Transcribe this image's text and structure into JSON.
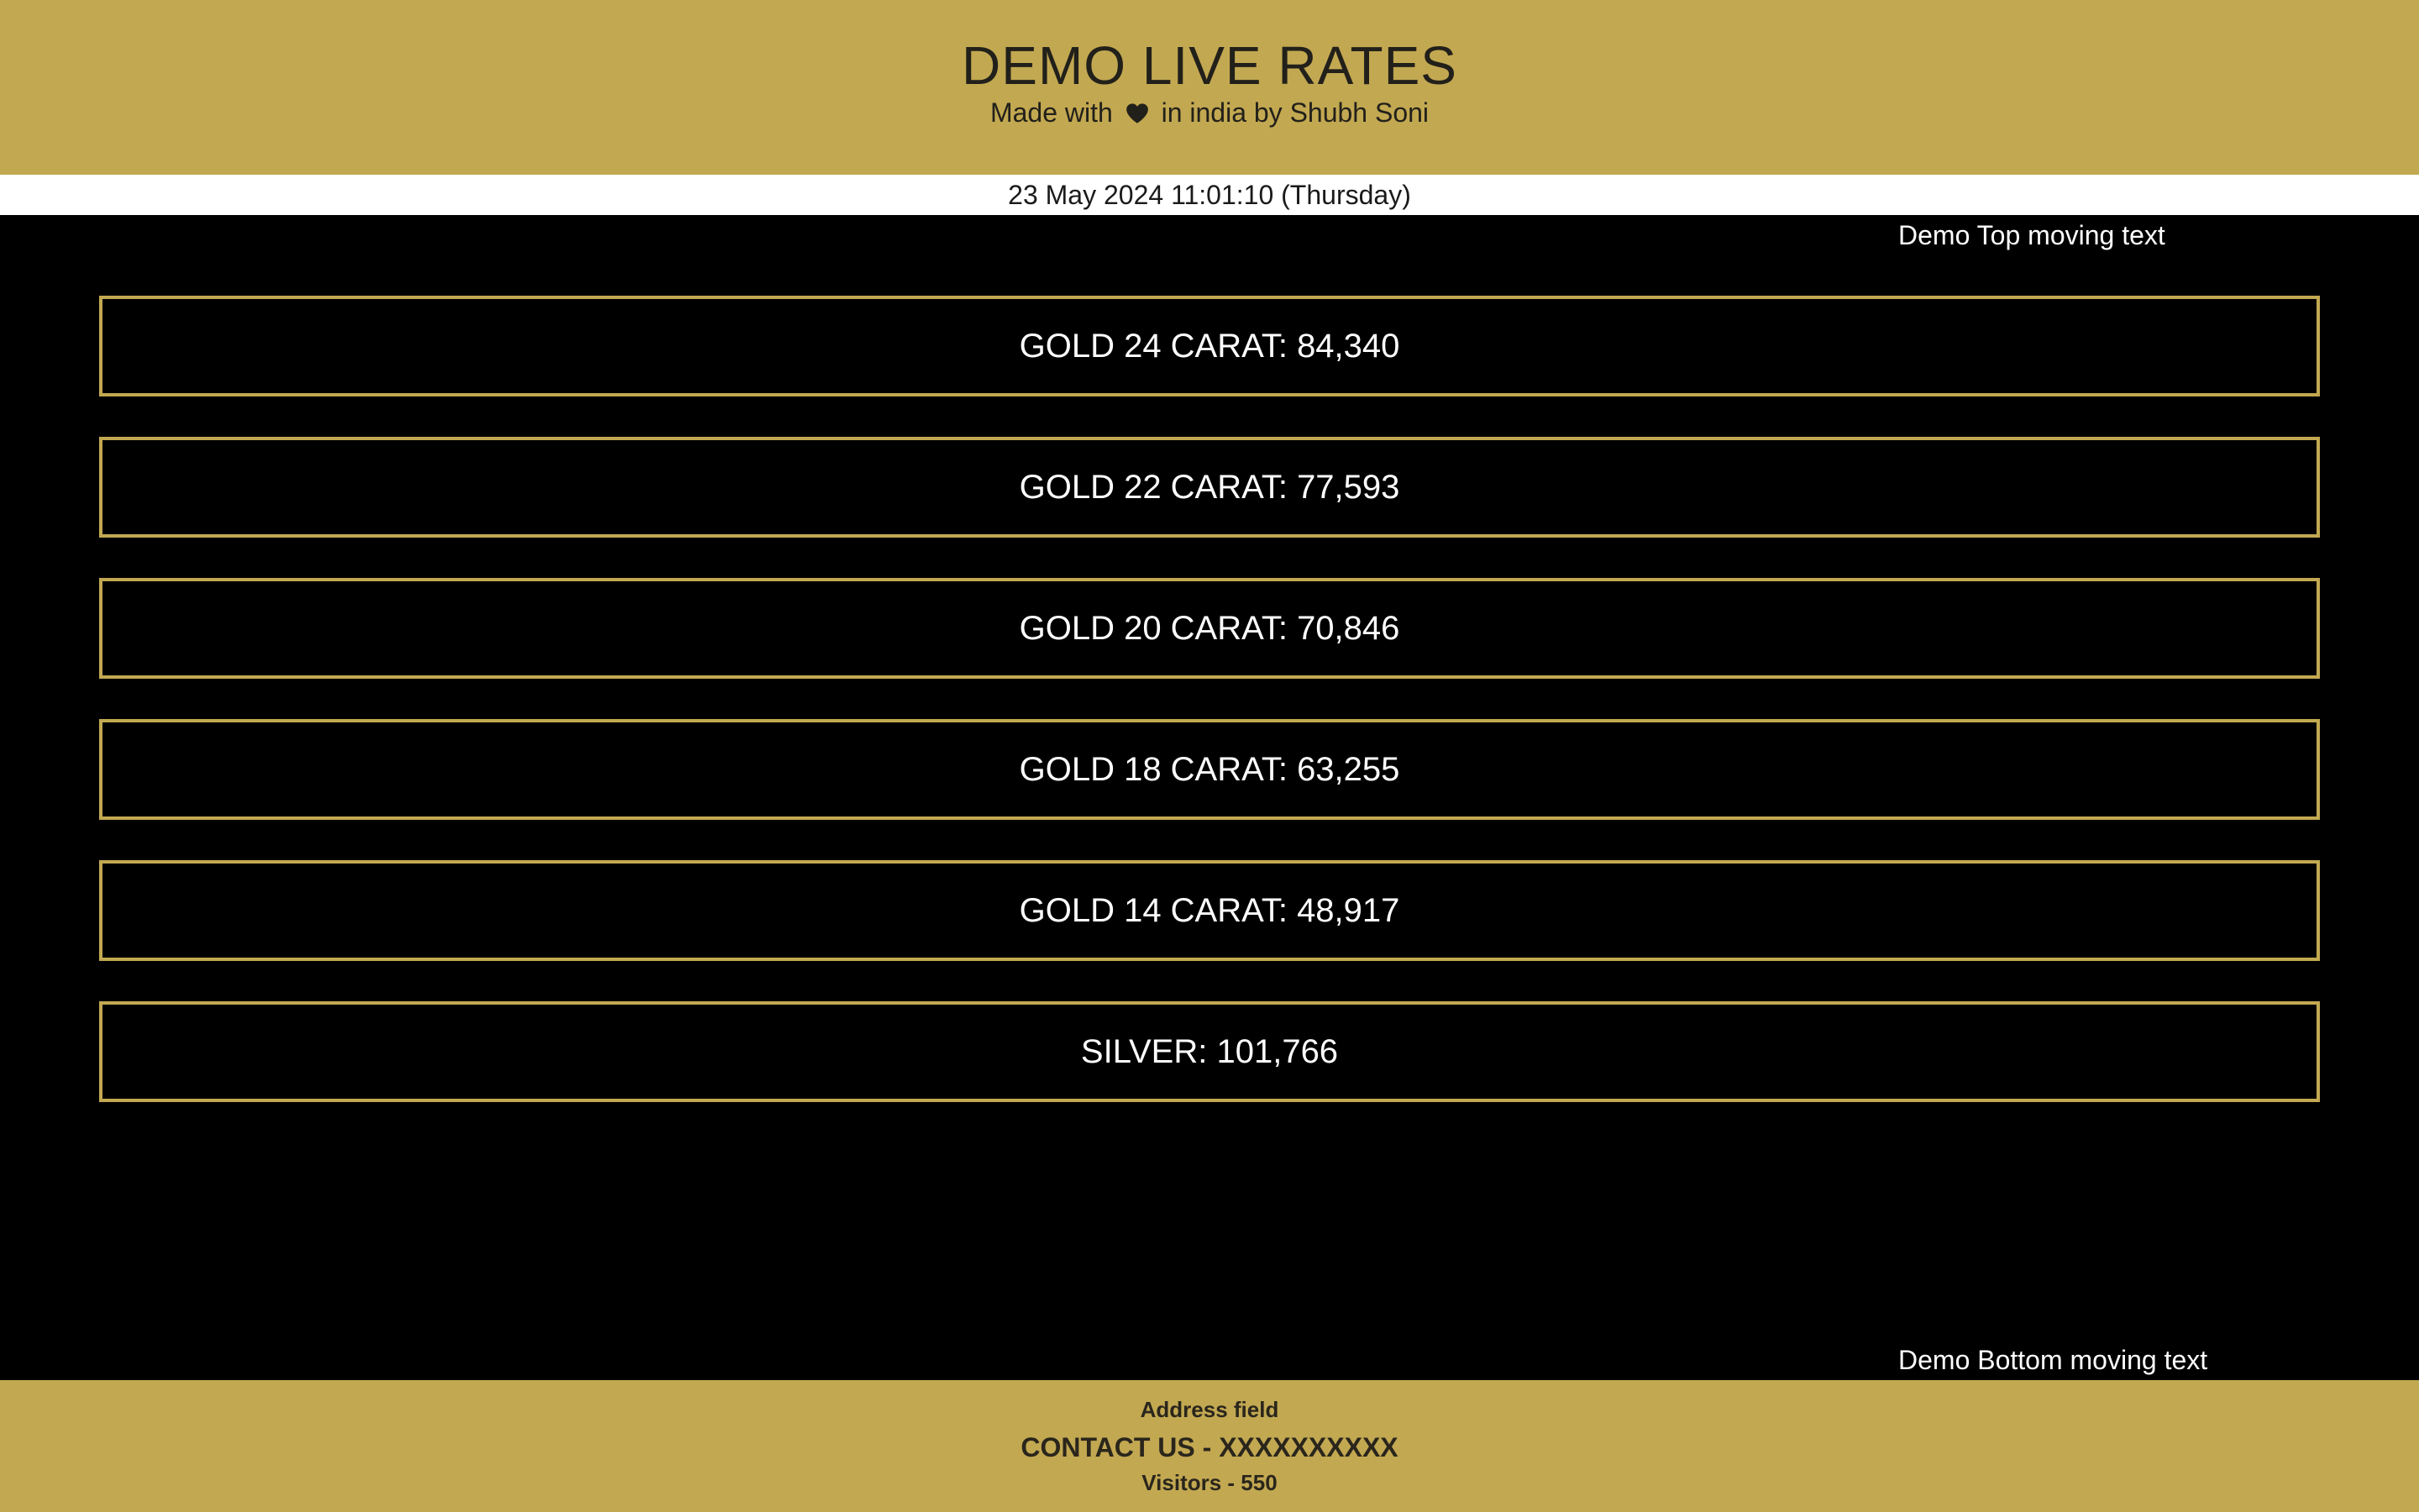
{
  "header": {
    "title": "DEMO LIVE RATES",
    "subtitle_prefix": "Made with",
    "subtitle_suffix": "in india by Shubh Soni",
    "heart_icon": "heart-icon"
  },
  "datetime": "23 May 2024 11:01:10 (Thursday)",
  "ticker": {
    "top": "Demo Top moving text",
    "bottom": "Demo Bottom moving text"
  },
  "rates": [
    {
      "label": "GOLD 24 CARAT: 84,340"
    },
    {
      "label": "GOLD 22 CARAT: 77,593"
    },
    {
      "label": "GOLD 20 CARAT: 70,846"
    },
    {
      "label": "GOLD 18 CARAT: 63,255"
    },
    {
      "label": "GOLD 14 CARAT: 48,917"
    },
    {
      "label": "SILVER: 101,766"
    }
  ],
  "footer": {
    "address": "Address field",
    "contact": "CONTACT US - XXXXXXXXXX",
    "visitors": "Visitors - 550"
  },
  "colors": {
    "brand_gold": "#c2a851",
    "background": "#000000",
    "rate_text": "#ffffff"
  }
}
